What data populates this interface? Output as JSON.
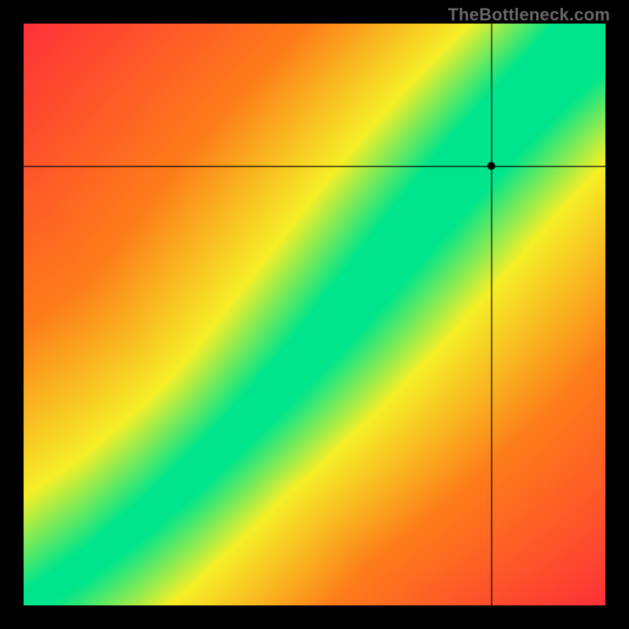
{
  "watermark": "TheBottleneck.com",
  "chart_data": {
    "type": "heatmap",
    "title": "",
    "xlabel": "",
    "ylabel": "",
    "xlim": [
      0,
      1
    ],
    "ylim": [
      0,
      1
    ],
    "description": "Diagonal optimal band heatmap showing bottleneck compatibility. Green band runs along a slightly curved diagonal from lower-left to upper-right representing balanced configurations; red corners (upper-left and lower-right) represent heavy bottleneck; yellow is transitional.",
    "optimal_curve_points": [
      [
        0.0,
        0.0
      ],
      [
        0.1,
        0.065
      ],
      [
        0.2,
        0.145
      ],
      [
        0.3,
        0.235
      ],
      [
        0.4,
        0.335
      ],
      [
        0.5,
        0.445
      ],
      [
        0.6,
        0.565
      ],
      [
        0.7,
        0.685
      ],
      [
        0.8,
        0.8
      ],
      [
        0.9,
        0.905
      ],
      [
        1.0,
        1.0
      ]
    ],
    "band_half_width_frac": 0.065,
    "crosshair": {
      "x": 0.805,
      "y": 0.755
    },
    "marker_radius_px": 5,
    "colors": {
      "best": "#00e58b",
      "good": "#f6f028",
      "mid": "#fd7d1a",
      "worst": "#fe2c3b"
    }
  },
  "canvas": {
    "size": 740,
    "offset": 30
  }
}
